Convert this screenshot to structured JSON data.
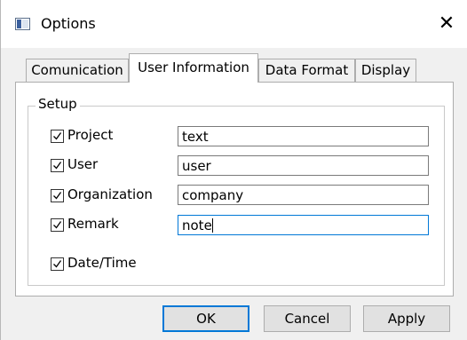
{
  "window": {
    "title": "Options",
    "close_glyph": "✕"
  },
  "tabs": [
    {
      "label": "Comunication",
      "active": false
    },
    {
      "label": "User Information",
      "active": true
    },
    {
      "label": "Data Format",
      "active": false
    },
    {
      "label": "Display",
      "active": false
    }
  ],
  "setup": {
    "group_label": "Setup",
    "fields": [
      {
        "label": "Project",
        "checked": true,
        "value": "text"
      },
      {
        "label": "User",
        "checked": true,
        "value": "user"
      },
      {
        "label": "Organization",
        "checked": true,
        "value": "company"
      },
      {
        "label": "Remark",
        "checked": true,
        "value": "note",
        "focused": true
      }
    ],
    "datetime": {
      "label": "Date/Time",
      "checked": true
    }
  },
  "buttons": {
    "ok": "OK",
    "cancel": "Cancel",
    "apply": "Apply"
  },
  "colors": {
    "focus_accent": "#0078d7",
    "button_face": "#e1e1e1",
    "dialog_bg": "#f0f0f0"
  },
  "icons": {
    "app": "window-app-icon",
    "close": "close-icon",
    "check": "checkmark-icon"
  }
}
